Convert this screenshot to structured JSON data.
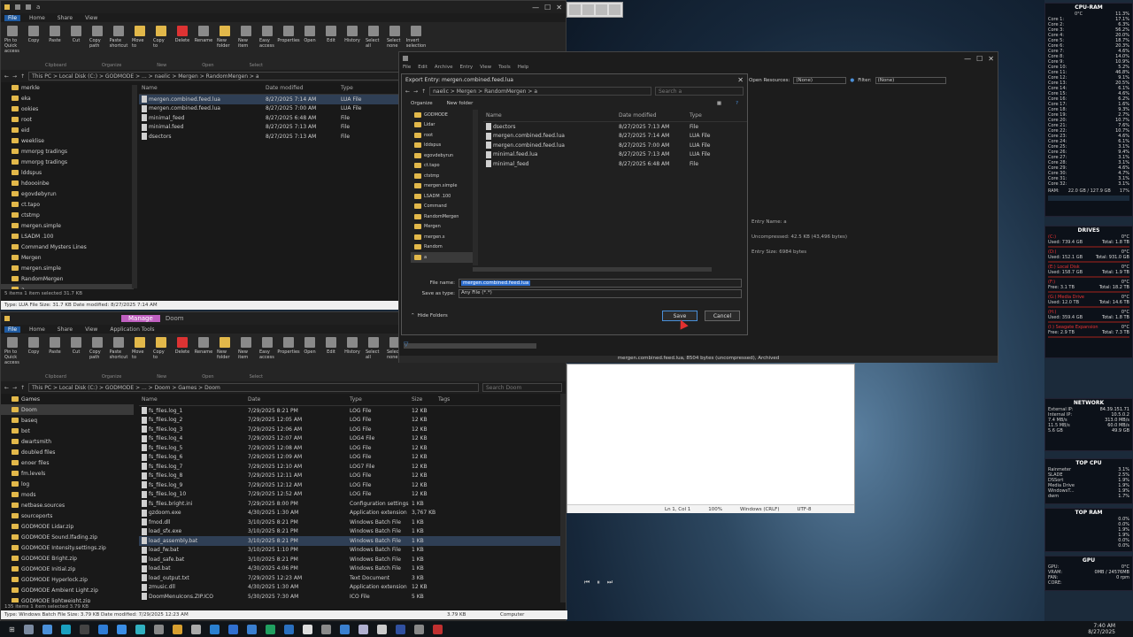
{
  "explorer_top": {
    "tabs": [
      "File",
      "Home",
      "Share",
      "View"
    ],
    "ribbon": [
      {
        "label": "Pin to Quick access",
        "icon": "pin-icon"
      },
      {
        "label": "Copy",
        "icon": "copy-icon"
      },
      {
        "label": "Paste",
        "icon": "paste-icon"
      },
      {
        "label": "Cut",
        "icon": "cut-icon"
      },
      {
        "label": "Copy path",
        "icon": "copy-path-icon"
      },
      {
        "label": "Paste shortcut",
        "icon": "paste-shortcut-icon"
      },
      {
        "label": "Move to",
        "icon": "move-to-icon"
      },
      {
        "label": "Copy to",
        "icon": "copy-to-icon"
      },
      {
        "label": "Delete",
        "icon": "delete-icon"
      },
      {
        "label": "Rename",
        "icon": "rename-icon"
      },
      {
        "label": "New folder",
        "icon": "new-folder-icon"
      },
      {
        "label": "New item",
        "icon": "new-item-icon"
      },
      {
        "label": "Easy access",
        "icon": "easy-access-icon"
      },
      {
        "label": "Properties",
        "icon": "properties-icon"
      },
      {
        "label": "Open",
        "icon": "open-icon"
      },
      {
        "label": "Edit",
        "icon": "edit-icon"
      },
      {
        "label": "History",
        "icon": "history-icon"
      },
      {
        "label": "Select all",
        "icon": "select-all-icon"
      },
      {
        "label": "Select none",
        "icon": "select-none-icon"
      },
      {
        "label": "Invert selection",
        "icon": "invert-selection-icon"
      }
    ],
    "sections": [
      "Clipboard",
      "Organize",
      "New",
      "Open",
      "Select"
    ],
    "path": "This PC > Local Disk (C:) > GODMODE > ... > naelic > Mergen > RandomMergen > a",
    "tree": [
      "merkle",
      "eka",
      "ookies",
      "root",
      "eid",
      "weeklise",
      "mmorpg tradings",
      "mmorpg tradings",
      "lddspus",
      "hdoooinbe",
      "egovdebyrun",
      "ct.tapo",
      "ctstmp",
      "mergen.simple",
      "LSADM .100",
      "Command Mysters Lines",
      "Mergen",
      "mergen.simple",
      "RandomMergen",
      "a"
    ],
    "columns": [
      "Name",
      "Date modified",
      "Type"
    ],
    "files": [
      {
        "name": "mergen.combined.feed.lua",
        "date": "8/27/2025 7:14 AM",
        "type": "LUA File",
        "sel": true
      },
      {
        "name": "mergen.combined.feed.lua",
        "date": "8/27/2025 7:00 AM",
        "type": "LUA File",
        "sel": false
      },
      {
        "name": "minimal_feed",
        "date": "8/27/2025 6:48 AM",
        "type": "File",
        "sel": false
      },
      {
        "name": "minimal.feed",
        "date": "8/27/2025 7:13 AM",
        "type": "File",
        "sel": false
      },
      {
        "name": "dsectors",
        "date": "8/27/2025 7:13 AM",
        "type": "File",
        "sel": false
      }
    ],
    "status": "5 items   1 item selected  31.7 KB",
    "bottom_status": "Type: LUA File Size: 31.7 KB Date modified: 8/27/2025 7:14 AM"
  },
  "explorer_bottom": {
    "tabs": [
      "File",
      "Home",
      "Share",
      "View",
      "Application Tools"
    ],
    "manage_tab": "Manage",
    "folder_tab": "Doom",
    "path": "This PC > Local Disk (C:) > GODMODE > ... > Doom > Games > Doom",
    "search_placeholder": "Search Doom",
    "tree": [
      "Games",
      "Doom",
      "baseq",
      "bot",
      "dwartsmith",
      "doubled files",
      "enoer files",
      "fm.levels",
      "log",
      "mods",
      "netbase.sources",
      "sourceports",
      "GODMODE Lidar.zip",
      "GODMODE Sound.lfading.zip",
      "GODMODE Intensity.settings.zip",
      "GODMODE Bright.zip",
      "GODMODE Initial.zip",
      "GODMODE Hyperlock.zip",
      "GODMODE Ambient Light.zip",
      "GODMODE lightweight.zip"
    ],
    "columns": [
      "Name",
      "Date",
      "Type",
      "Size",
      "Tags"
    ],
    "files": [
      {
        "name": "fs_files.log_1",
        "date": "7/29/2025 8:21 PM",
        "type": "LOG File",
        "size": "12 KB"
      },
      {
        "name": "fs_files.log_2",
        "date": "7/29/2025 12:05 AM",
        "type": "LOG File",
        "size": "12 KB"
      },
      {
        "name": "fs_files.log_3",
        "date": "7/29/2025 12:06 AM",
        "type": "LOG File",
        "size": "12 KB"
      },
      {
        "name": "fs_files.log_4",
        "date": "7/29/2025 12:07 AM",
        "type": "LOG4 File",
        "size": "12 KB"
      },
      {
        "name": "fs_files.log_5",
        "date": "7/29/2025 12:08 AM",
        "type": "LOG File",
        "size": "12 KB"
      },
      {
        "name": "fs_files.log_6",
        "date": "7/29/2025 12:09 AM",
        "type": "LOG File",
        "size": "12 KB"
      },
      {
        "name": "fs_files.log_7",
        "date": "7/29/2025 12:10 AM",
        "type": "LOG7 File",
        "size": "12 KB"
      },
      {
        "name": "fs_files.log_8",
        "date": "7/29/2025 12:11 AM",
        "type": "LOG File",
        "size": "12 KB"
      },
      {
        "name": "fs_files.log_9",
        "date": "7/29/2025 12:12 AM",
        "type": "LOG File",
        "size": "12 KB"
      },
      {
        "name": "fs_files.log_10",
        "date": "7/29/2025 12:52 AM",
        "type": "LOG File",
        "size": "12 KB"
      },
      {
        "name": "fs_files.bright.ini",
        "date": "7/29/2025 8:00 PM",
        "type": "Configuration settings",
        "size": "1 KB"
      },
      {
        "name": "gzdoom.exe",
        "date": "4/30/2025 1:30 AM",
        "type": "Application extension",
        "size": "3,767 KB"
      },
      {
        "name": "fmod.dll",
        "date": "3/10/2025 8:21 PM",
        "type": "Windows Batch File",
        "size": "1 KB"
      },
      {
        "name": "load_sfx.exe",
        "date": "3/10/2025 8:21 PM",
        "type": "Windows Batch File",
        "size": "1 KB"
      },
      {
        "name": "load_assembly.bat",
        "date": "3/10/2025 8:21 PM",
        "type": "Windows Batch File",
        "size": "1 KB"
      },
      {
        "name": "load_fw.bat",
        "date": "3/10/2025 1:10 PM",
        "type": "Windows Batch File",
        "size": "1 KB"
      },
      {
        "name": "load_safe.bat",
        "date": "3/10/2025 8:21 PM",
        "type": "Windows Batch File",
        "size": "1 KB"
      },
      {
        "name": "load.bat",
        "date": "4/30/2025 4:06 PM",
        "type": "Windows Batch File",
        "size": "1 KB"
      },
      {
        "name": "load_output.txt",
        "date": "7/29/2025 12:23 AM",
        "type": "Text Document",
        "size": "3 KB"
      },
      {
        "name": "zmusic.dll",
        "date": "4/30/2025 1:30 AM",
        "type": "Application extension",
        "size": "12 KB"
      },
      {
        "name": "DoomMenuIcons.ZIP.ICO",
        "date": "5/30/2025 7:30 AM",
        "type": "ICO File",
        "size": "5 KB"
      }
    ],
    "status": "135 items   1 item selected  3.79 KB",
    "bottom_status": "Type: Windows Batch File Size: 3.79 KB Date modified: 7/29/2025 12:23 AM",
    "bottom_size": "3.79 KB",
    "bottom_location": "Computer"
  },
  "editor": {
    "menu": [
      "File",
      "Edit",
      "Archive",
      "Entry",
      "View",
      "Tools",
      "Help"
    ],
    "open_resource_label": "Open Resources:",
    "open_resource_value": "(None)",
    "filter_label": "Filter:",
    "filter_value": "(None)",
    "info_lines": [
      "Entry Name: a",
      "Uncompressed: 42.5 KB (43,496 bytes)",
      "Entry Size: 6984 bytes"
    ],
    "status": "mergen.combined.feed.lua, 8504 bytes (uncompressed), Archived"
  },
  "save_dialog": {
    "title": "Export Entry: mergen.combined.feed.lua",
    "path": "naelic > Mergen > RandomMergen > a",
    "search_placeholder": "Search a",
    "organize": "Organize",
    "new_folder": "New folder",
    "tree": [
      "GODMODE",
      "Lidar",
      "root",
      "lddspus",
      "egovdebyrun",
      "ct.tapo",
      "ctstmp",
      "mergen.simple",
      "LSADM .100",
      "Command",
      "RandomMergen",
      "Mergen",
      "mergen.s",
      "Random",
      "a"
    ],
    "columns": [
      "Name",
      "Date modified",
      "Type"
    ],
    "files": [
      {
        "name": "dsectors",
        "date": "8/27/2025 7:13 AM",
        "type": "File"
      },
      {
        "name": "mergen.combined.feed.lua",
        "date": "8/27/2025 7:14 AM",
        "type": "LUA File"
      },
      {
        "name": "mergen.combined.feed.lua",
        "date": "8/27/2025 7:00 AM",
        "type": "LUA File"
      },
      {
        "name": "minimal.feed.lua",
        "date": "8/27/2025 7:13 AM",
        "type": "LUA File"
      },
      {
        "name": "minimal_feed",
        "date": "8/27/2025 6:48 AM",
        "type": "File"
      }
    ],
    "filename_label": "File name:",
    "filename_value": "mergen.combined.feed.lua",
    "savetype_label": "Save as type:",
    "savetype_value": "Any File (*.*)",
    "hide_folders": "Hide Folders",
    "save_button": "Save",
    "cancel_button": "Cancel"
  },
  "white_window": {
    "status": [
      "Ln 1, Col 1",
      "100%",
      "Windows (CRLF)",
      "UTF-8"
    ]
  },
  "monitor": {
    "cpu_title": "CPU-RAM",
    "cpu_temp": "0°C",
    "cpu_total": "11.3%",
    "cores": [
      {
        "n": "Core 1:",
        "v": "17.1%"
      },
      {
        "n": "Core 2:",
        "v": "6.3%"
      },
      {
        "n": "Core 3:",
        "v": "56.2%"
      },
      {
        "n": "Core 4:",
        "v": "20.0%"
      },
      {
        "n": "Core 5:",
        "v": "18.7%"
      },
      {
        "n": "Core 6:",
        "v": "20.3%"
      },
      {
        "n": "Core 7:",
        "v": "4.6%"
      },
      {
        "n": "Core 8:",
        "v": "14.0%"
      },
      {
        "n": "Core 9:",
        "v": "10.9%"
      },
      {
        "n": "Core 10:",
        "v": "5.2%"
      },
      {
        "n": "Core 11:",
        "v": "46.8%"
      },
      {
        "n": "Core 12:",
        "v": "9.1%"
      },
      {
        "n": "Core 13:",
        "v": "20.5%"
      },
      {
        "n": "Core 14:",
        "v": "6.1%"
      },
      {
        "n": "Core 15:",
        "v": "4.6%"
      },
      {
        "n": "Core 16:",
        "v": "6.2%"
      },
      {
        "n": "Core 17:",
        "v": "1.6%"
      },
      {
        "n": "Core 18:",
        "v": "9.3%"
      },
      {
        "n": "Core 19:",
        "v": "2.7%"
      },
      {
        "n": "Core 20:",
        "v": "10.7%"
      },
      {
        "n": "Core 21:",
        "v": "7.6%"
      },
      {
        "n": "Core 22:",
        "v": "10.7%"
      },
      {
        "n": "Core 23:",
        "v": "4.6%"
      },
      {
        "n": "Core 24:",
        "v": "6.1%"
      },
      {
        "n": "Core 25:",
        "v": "3.1%"
      },
      {
        "n": "Core 26:",
        "v": "9.4%"
      },
      {
        "n": "Core 27:",
        "v": "3.1%"
      },
      {
        "n": "Core 28:",
        "v": "3.1%"
      },
      {
        "n": "Core 29:",
        "v": "4.6%"
      },
      {
        "n": "Core 30:",
        "v": "4.7%"
      },
      {
        "n": "Core 31:",
        "v": "3.1%"
      },
      {
        "n": "Core 32:",
        "v": "3.1%"
      }
    ],
    "ram_label": "RAM:",
    "ram_value": "22.0 GB / 127.9 GB",
    "ram_pct": "17%",
    "drives_title": "DRIVES",
    "drives": [
      {
        "name": "(C:)",
        "used": "Used: 739.4 GB",
        "total": "Total: 1.8 TB",
        "temp": "0°C"
      },
      {
        "name": "(D:)",
        "used": "Used: 152.1 GB",
        "total": "Total: 931.0 GB",
        "temp": "0°C"
      },
      {
        "name": "(E:) Local Disk",
        "used": "Used: 158.7 GB",
        "total": "Total: 1.9 TB",
        "temp": "0°C"
      },
      {
        "name": "(F:)",
        "used": "Free: 3.1 TB",
        "total": "Total: 18.2 TB",
        "temp": "0°C"
      },
      {
        "name": "(G:) Media Drive",
        "used": "Used: 12.0 TB",
        "total": "Total: 14.6 TB",
        "temp": "0°C"
      },
      {
        "name": "(H:)",
        "used": "Used: 359.4 GB",
        "total": "Total: 1.8 TB",
        "temp": "0°C"
      },
      {
        "name": "(I:) Seagate Expansion",
        "used": "Free: 2.9 TB",
        "total": "Total: 7.3 TB",
        "temp": "0°C"
      }
    ],
    "network_title": "NETWORK",
    "network": [
      {
        "n": "External IP:",
        "v": "84.39.151.71"
      },
      {
        "n": "Internal IP:",
        "v": "10.5.0.2"
      },
      {
        "n": "7.4 MB/s",
        "v": "313.0 MB/s"
      },
      {
        "n": "11.5 MB/s",
        "v": "60.0 MB/s"
      },
      {
        "n": "5.6 GB",
        "v": "49.9 GB"
      }
    ],
    "topcpu_title": "TOP CPU",
    "topcpu": [
      {
        "n": "Rainmeter",
        "v": "3.1%"
      },
      {
        "n": "SLADE",
        "v": "2.5%"
      },
      {
        "n": "DSSort",
        "v": "1.9%"
      },
      {
        "n": "Media Drive",
        "v": "1.9%"
      },
      {
        "n": "WindowsT...",
        "v": "1.9%"
      },
      {
        "n": "dwm",
        "v": "1.7%"
      }
    ],
    "toprm_title": "TOP RAM",
    "topram": [
      {
        "n": "",
        "v": "0.0%"
      },
      {
        "n": "",
        "v": "0.0%"
      },
      {
        "n": "",
        "v": "1.9%"
      },
      {
        "n": "",
        "v": "1.9%"
      },
      {
        "n": "",
        "v": "0.0%"
      },
      {
        "n": "",
        "v": "0.0%"
      }
    ],
    "gpu_title": "GPU",
    "gpu": [
      {
        "n": "GPU:",
        "v": "0°C"
      },
      {
        "n": "VRAM:",
        "v": "0MB / 24576MB"
      },
      {
        "n": "FAN:",
        "v": "0 rpm"
      },
      {
        "n": "CORE:",
        "v": ""
      }
    ]
  },
  "taskbar": {
    "time": "7:40 AM",
    "date": "8/27/2025"
  }
}
